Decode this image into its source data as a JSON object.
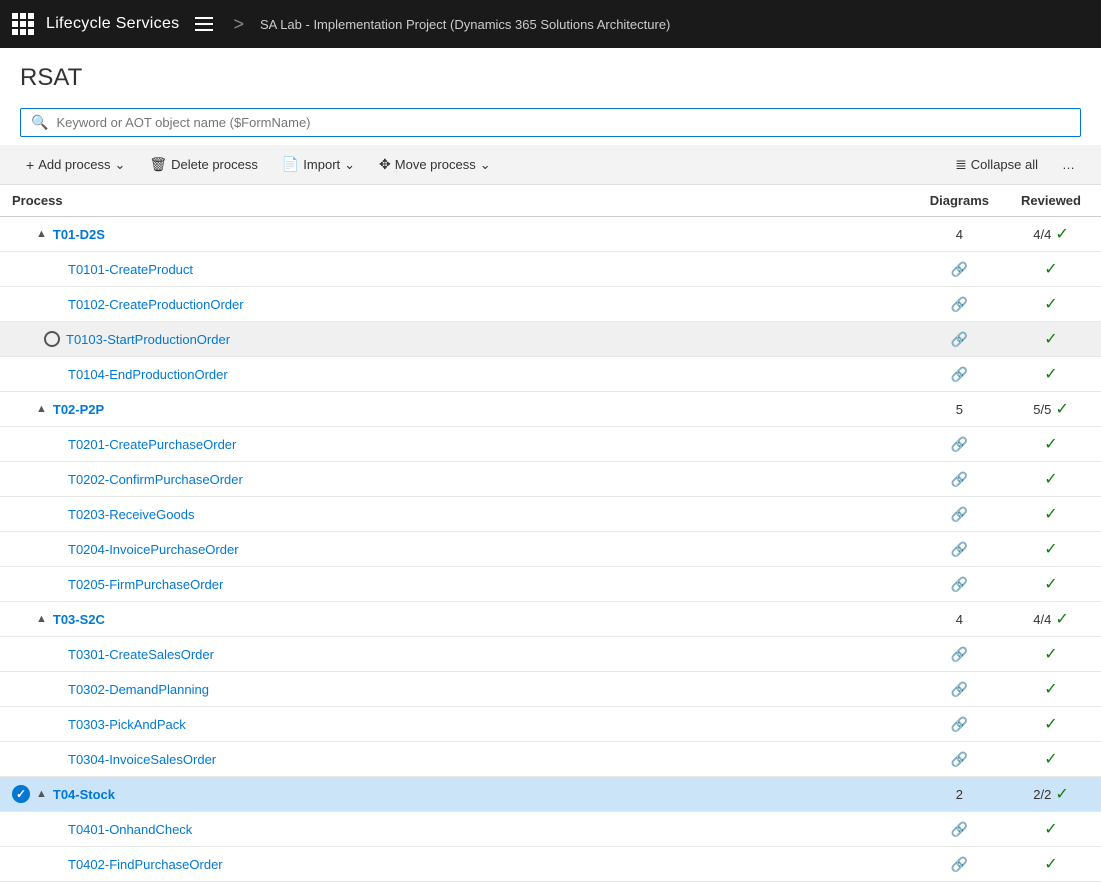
{
  "nav": {
    "title": "Lifecycle Services",
    "breadcrumb": "SA Lab - Implementation Project (Dynamics 365 Solutions Architecture)"
  },
  "page": {
    "title": "RSAT"
  },
  "search": {
    "placeholder": "Keyword or AOT object name ($FormName)"
  },
  "toolbar": {
    "add_process": "Add process",
    "delete_process": "Delete process",
    "import": "Import",
    "move_process": "Move process",
    "collapse_all": "Collapse all"
  },
  "table": {
    "col_process": "Process",
    "col_diagrams": "Diagrams",
    "col_reviewed": "Reviewed",
    "groups": [
      {
        "id": "T01-D2S",
        "label": "T01-D2S",
        "diagrams": "4",
        "reviewed": "4/4",
        "reviewed_check": true,
        "children": [
          {
            "id": "T0101",
            "label": "T0101-CreateProduct",
            "diagrams": "🔗",
            "reviewed_check": true,
            "selected": false
          },
          {
            "id": "T0102",
            "label": "T0102-CreateProductionOrder",
            "diagrams": "🔗",
            "reviewed_check": true,
            "selected": false
          },
          {
            "id": "T0103",
            "label": "T0103-StartProductionOrder",
            "diagrams": "🔗",
            "reviewed_check": true,
            "selected": "radio"
          },
          {
            "id": "T0104",
            "label": "T0104-EndProductionOrder",
            "diagrams": "🔗",
            "reviewed_check": true,
            "selected": false
          }
        ]
      },
      {
        "id": "T02-P2P",
        "label": "T02-P2P",
        "diagrams": "5",
        "reviewed": "5/5",
        "reviewed_check": true,
        "children": [
          {
            "id": "T0201",
            "label": "T0201-CreatePurchaseOrder",
            "diagrams": "🔗",
            "reviewed_check": true,
            "selected": false
          },
          {
            "id": "T0202",
            "label": "T0202-ConfirmPurchaseOrder",
            "diagrams": "🔗",
            "reviewed_check": true,
            "selected": false
          },
          {
            "id": "T0203",
            "label": "T0203-ReceiveGoods",
            "diagrams": "🔗",
            "reviewed_check": true,
            "selected": false
          },
          {
            "id": "T0204",
            "label": "T0204-InvoicePurchaseOrder",
            "diagrams": "🔗",
            "reviewed_check": true,
            "selected": false
          },
          {
            "id": "T0205",
            "label": "T0205-FirmPurchaseOrder",
            "diagrams": "🔗",
            "reviewed_check": true,
            "selected": false
          }
        ]
      },
      {
        "id": "T03-S2C",
        "label": "T03-S2C",
        "diagrams": "4",
        "reviewed": "4/4",
        "reviewed_check": true,
        "children": [
          {
            "id": "T0301",
            "label": "T0301-CreateSalesOrder",
            "diagrams": "🔗",
            "reviewed_check": true,
            "selected": false
          },
          {
            "id": "T0302",
            "label": "T0302-DemandPlanning",
            "diagrams": "🔗",
            "reviewed_check": true,
            "selected": false
          },
          {
            "id": "T0303",
            "label": "T0303-PickAndPack",
            "diagrams": "🔗",
            "reviewed_check": true,
            "selected": false
          },
          {
            "id": "T0304",
            "label": "T0304-InvoiceSalesOrder",
            "diagrams": "🔗",
            "reviewed_check": true,
            "selected": false
          }
        ]
      },
      {
        "id": "T04-Stock",
        "label": "T04-Stock",
        "diagrams": "2",
        "reviewed": "2/2",
        "reviewed_check": true,
        "selected": "blue",
        "children": [
          {
            "id": "T0401",
            "label": "T0401-OnhandCheck",
            "diagrams": "🔗",
            "reviewed_check": true,
            "selected": false
          },
          {
            "id": "T0402",
            "label": "T0402-FindPurchaseOrder",
            "diagrams": "🔗",
            "reviewed_check": true,
            "selected": false
          }
        ]
      }
    ]
  }
}
